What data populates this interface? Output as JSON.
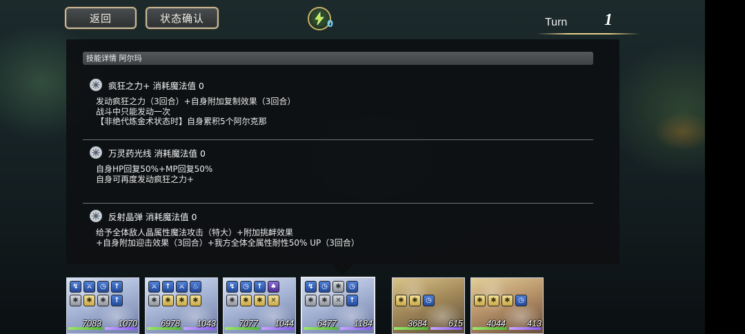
{
  "header": {
    "back_label": "返回",
    "status_label": "状态确认",
    "energy_count": "0",
    "turn_label": "Turn",
    "turn_number": "1"
  },
  "panel": {
    "title": "技能详情 阿尔玛",
    "skills": [
      {
        "name": "疯狂之力+ 消耗魔法值 0",
        "description": "发动疯狂之力（3回合）+自身附加复制效果（3回合）\n战斗中只能发动一次\n【非绝代炼金术状态时】自身累积5个阿尔克那"
      },
      {
        "name": "万灵药光线 消耗魔法值 0",
        "description": "自身HP回复50%+MP回复50%\n自身可再度发动疯狂之力+"
      },
      {
        "name": "反射晶弹 消耗魔法值 0",
        "description": "给予全体敌人晶属性魔法攻击（特大）+附加挑衅效果\n+自身附加迎击效果（3回合）+我方全体全属性耐性50% UP（3回合）"
      }
    ]
  },
  "party": [
    {
      "hp": "7083",
      "mp": "1070",
      "hp_ratio": 1.0,
      "mp_ratio": 1.0
    },
    {
      "hp": "6978",
      "mp": "1043",
      "hp_ratio": 1.0,
      "mp_ratio": 1.0
    },
    {
      "hp": "7077",
      "mp": "1044",
      "hp_ratio": 1.0,
      "mp_ratio": 1.0
    },
    {
      "hp": "6477",
      "mp": "1184",
      "hp_ratio": 1.0,
      "mp_ratio": 1.0
    },
    {
      "hp": "3684",
      "mp": "615",
      "hp_ratio": 1.0,
      "mp_ratio": 1.0
    },
    {
      "hp": "4044",
      "mp": "413",
      "hp_ratio": 1.0,
      "mp_ratio": 1.0
    }
  ],
  "colors": {
    "button_border": "#c7b995",
    "energy_count": "#6fd3ff",
    "hp_bar": "#55b63a",
    "mp_bar": "#8b5cf0"
  }
}
